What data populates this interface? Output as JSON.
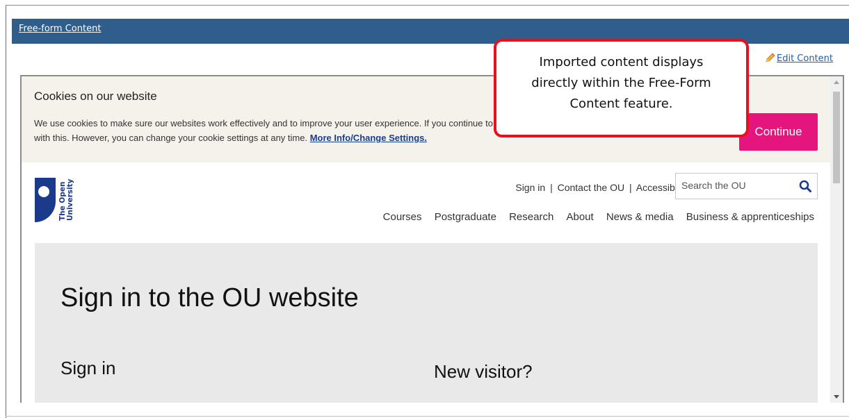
{
  "panel": {
    "header_link": "Free-form Content",
    "edit_link": "Edit Content"
  },
  "callout": {
    "text": "Imported content displays directly within the Free-Form Content feature."
  },
  "cookie_banner": {
    "title": "Cookies on our website",
    "text_before_link": "We use cookies to make sure our websites work effectively and to improve your user experience. If you continue to use this website we will assume that you are happy with this. However, you can change your cookie settings at any time. ",
    "more_link": "More Info/Change Settings.",
    "continue_label": "Continue"
  },
  "ou_header": {
    "logo_text": "The Open University",
    "top_links": [
      "Sign in",
      "Contact the OU",
      "Accessibility"
    ],
    "separator": "|",
    "search_placeholder": "Search the OU",
    "nav": [
      "Courses",
      "Postgraduate",
      "Research",
      "About",
      "News & media",
      "Business & apprenticeships"
    ]
  },
  "signin": {
    "title": "Sign in to the OU website",
    "signin_heading": "Sign in",
    "new_visitor_heading": "New visitor?"
  },
  "colors": {
    "header_bar": "#2f5d8c",
    "continue_button": "#e4157c",
    "callout_border": "#e8101d",
    "ou_blue": "#1b3a8c"
  }
}
